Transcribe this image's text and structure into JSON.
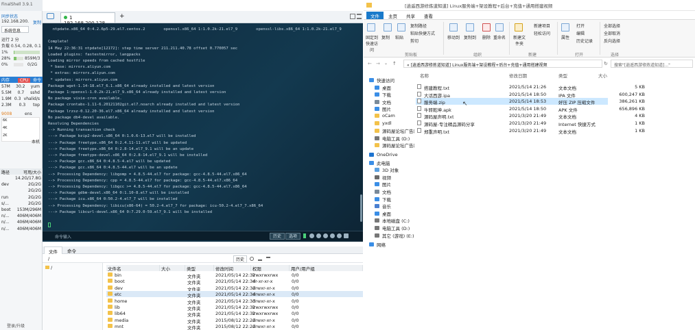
{
  "finalshell": {
    "title": "FinalShell 3.9.1",
    "sync_label": "同步状态",
    "host": "192.168.200.1...",
    "copy_label": "复制",
    "sysinfo_button": "系统信息",
    "uptime": "运行 2 分",
    "load": "负载 0.54, 0.28, 0.11",
    "cpu_pct": "1%",
    "cpu_fill": 0.01,
    "mem_pct": "28%",
    "mem_value": "859M/3",
    "mem_fill": 0.28,
    "swap_pct": "0%",
    "swap_value": "0/2G",
    "swap_fill": 0.0,
    "proc_header": {
      "mem": "内存",
      "cpu": "CPU",
      "cmd": "命令"
    },
    "processes": [
      {
        "mem": "57M",
        "cpu": "30.2",
        "cmd": "yum"
      },
      {
        "mem": "5.5M",
        "cpu": "0.7",
        "cmd": "sshd"
      },
      {
        "mem": "1.9M",
        "cpu": "0.3",
        "cmd": "vhalid/s"
      },
      {
        "mem": "2.3M",
        "cpu": "0.3",
        "cmd": "top"
      }
    ],
    "net_up": "9008",
    "net_label": "ens",
    "net_axis": [
      "6K",
      "4K",
      "2K"
    ],
    "net_host_label": "本机",
    "disk_header": {
      "path": "路径",
      "free": "可用/大小"
    },
    "disks": [
      {
        "path": "",
        "free": "14.2G/17.8G"
      },
      {
        "path": "dev",
        "free": "2G/2G"
      },
      {
        "path": "",
        "free": "2G/2G"
      },
      {
        "path": "run",
        "free": "2G/2G"
      },
      {
        "path": "s/...",
        "free": "2G/2G"
      },
      {
        "path": "boot",
        "free": "153M/296M"
      },
      {
        "path": "n/...",
        "free": "406M/406M"
      },
      {
        "path": "n/...",
        "free": "406M/406M"
      },
      {
        "path": "n/...",
        "free": "406M/406M"
      }
    ],
    "login_link": "登录/升级",
    "tab_label": "1 192.168.200.128",
    "add_tab": "+",
    "terminal_lines": [
      "  ntpdate.x86_64 0:4.2.6p5-29.el7.centos.2        openssl.x86_64 1:1.0.2k-21.el7_9        openssl-libs.x86_64 1:1.0.2k-21.el7_9",
      "",
      "Complete!",
      "14 May 22:36:31 ntpdate[12172]: step time server 211.211.40.78 offset 0.770057 sec",
      "Loaded plugins: fastestmirror, langpacks",
      "Loading mirror speeds from cached hostfile",
      " * base: mirrors.aliyun.com",
      " * extras: mirrors.aliyun.com",
      " * updates: mirrors.aliyun.com",
      "Package wget-1.14-18.el7_6.1.x86_64 already installed and latest version",
      "Package 1:openssl-1.0.2k-21.el7_9.x86_64 already installed and latest version",
      "No package vixie-cron available.",
      "Package crontabs-1.11-6.20121102git.el7.noarch already installed and latest version",
      "Package lrzsz-0.12.20-36.el7.x86_64 already installed and latest version",
      "No package db4-devel available.",
      "Resolving Dependencies",
      "--> Running transaction check",
      "---> Package bzip2-devel.x86_64 0:1.0.6-13.el7 will be installed",
      "---> Package freetype.x86_64 0:2.4.11-11.el7 will be updated",
      "---> Package freetype.x86_64 0:2.8-14.el7_9.1 will be an update",
      "---> Package freetype-devel.x86_64 0:2.8-14.el7_9.1 will be installed",
      "---> Package gcc.x86_64 0:4.8.5-4.el7 will be updated",
      "---> Package gcc.x86_64 0:4.8.5-44.el7 will be an update",
      "--> Processing Dependency: libgomp = 4.8.5-44.el7 for package: gcc-4.8.5-44.el7.x86_64",
      "--> Processing Dependency: cpp = 4.8.5-44.el7 for package: gcc-4.8.5-44.el7.x86_64",
      "--> Processing Dependency: libgcc >= 4.8.5-44.el7 for package: gcc-4.8.5-44.el7.x86_64",
      "---> Package gdbm-devel.x86_64 0:1.10-8.el7 will be installed",
      "---> Package icu.x86_64 0:50.2-4.el7_7 will be installed",
      "--> Processing Dependency: libicu(x86-64) = 50.2-4.el7_7 for package: icu-50.2-4.el7_7.x86_64",
      "---> Package libcurl-devel.x86_64 0:7.29.0-59.el7_9.1 will be installed"
    ],
    "command_input_label": "命令输入",
    "history_button": "历史",
    "options_button": "选项",
    "file_tabs": [
      "文件",
      "命令"
    ],
    "file_path": "/",
    "file_history": "历史",
    "file_columns": [
      "文件名",
      "大小",
      "类型",
      "修改时间",
      "权限",
      "用户/用户组"
    ],
    "files": [
      {
        "name": "bin",
        "size": "",
        "type": "文件夹",
        "mtime": "2021/05/14 22:32",
        "perm": "lrwxrwxrwx",
        "owner": "0/0"
      },
      {
        "name": "boot",
        "size": "",
        "type": "文件夹",
        "mtime": "2021/05/14 22:34",
        "perm": "dr-xr-xr-x",
        "owner": "0/0"
      },
      {
        "name": "dev",
        "size": "",
        "type": "文件夹",
        "mtime": "2021/05/14 22:32",
        "perm": "drwxr-xr-x",
        "owner": "0/0"
      },
      {
        "name": "etc",
        "size": "",
        "type": "文件夹",
        "mtime": "2021/05/14 22:34",
        "perm": "drwxr-xr-x",
        "owner": "0/0"
      },
      {
        "name": "home",
        "size": "",
        "type": "文件夹",
        "mtime": "2021/05/14 22:33",
        "perm": "drwxr-xr-x",
        "owner": "0/0"
      },
      {
        "name": "lib",
        "size": "",
        "type": "文件夹",
        "mtime": "2021/05/14 22:32",
        "perm": "lrwxrwxrwx",
        "owner": "0/0"
      },
      {
        "name": "lib64",
        "size": "",
        "type": "文件夹",
        "mtime": "2021/05/14 22:32",
        "perm": "lrwxrwxrwx",
        "owner": "0/0"
      },
      {
        "name": "media",
        "size": "",
        "type": "文件夹",
        "mtime": "2015/08/12 22:22",
        "perm": "drwxr-xr-x",
        "owner": "0/0"
      },
      {
        "name": "mnt",
        "size": "",
        "type": "文件夹",
        "mtime": "2015/08/12 22:22",
        "perm": "drwxr-xr-x",
        "owner": "0/0"
      }
    ]
  },
  "explorer": {
    "title": "[逍遥西游修炼道知道] Linux服务端+架设教程+后台+充值+通用搭建视频",
    "ribbon_tabs": [
      "文件",
      "主页",
      "共享",
      "查看"
    ],
    "ribbon_buttons": {
      "pin": "固定到快速访问",
      "copy": "复制",
      "paste": "粘贴",
      "copy_path": "复制路径",
      "paste_shortcut": "粘贴快捷方式",
      "cut": "剪切",
      "move_to": "移动到",
      "copy_to": "复制到",
      "delete": "删除",
      "rename": "重命名",
      "new_folder": "新建文件夹",
      "new_item": "新建项目",
      "easy_access": "轻松访问",
      "properties": "属性",
      "open": "打开",
      "edit": "编辑",
      "history": "历史记录",
      "select_all": "全部选择",
      "select_none": "全部取消",
      "invert": "反向选择"
    },
    "ribbon_groups": [
      "剪贴板",
      "组织",
      "新建",
      "打开",
      "选择"
    ],
    "address": "« [逍遥西游修炼道知道] Linux服务端+架设教程+后台+充值+通用搭建视频",
    "search_placeholder": "搜索\"[逍遥西游修炼道知道]...\"",
    "nav_items": [
      "快速访问",
      "桌面",
      "下载",
      "文档",
      "图片",
      "oCam",
      "yxdl",
      "源码屋论坛广告教程",
      "电脑工具 (D:)",
      "源码屋论坛广告教程",
      "OneDrive",
      "此电脑",
      "3D 对象",
      "视频",
      "图片",
      "文档",
      "下载",
      "音乐",
      "桌面",
      "本地磁盘 (C:)",
      "电脑工具 (D:)",
      "其它 (游戏) (E:)",
      "网络"
    ],
    "columns": [
      "名称",
      "修改日期",
      "类型",
      "大小"
    ],
    "files": [
      {
        "name": "搭建教程.txt",
        "date": "2021/5/14 21:26",
        "type": "文本文档",
        "size": "5 KB"
      },
      {
        "name": "大话西游.ipa",
        "date": "2021/5/14 18:50",
        "type": "IPA 文件",
        "size": "600,247 KB"
      },
      {
        "name": "服务端.zip",
        "date": "2021/5/14 18:53",
        "type": "好压 ZIP 压缩文件",
        "size": "386,261 KB"
      },
      {
        "name": "牛转乾坤.apk",
        "date": "2021/5/14 18:50",
        "type": "APK 文件",
        "size": "656,896 KB"
      },
      {
        "name": "源码屋声明.txt",
        "date": "2021/3/20 21:49",
        "type": "文本文档",
        "size": "4 KB"
      },
      {
        "name": "源码屋-专注精品源码分享",
        "date": "2021/3/20 21:49",
        "type": "Internet 快捷方式",
        "size": "1 KB"
      },
      {
        "name": "郑重声明.txt",
        "date": "2021/3/20 21:49",
        "type": "文本文档",
        "size": "1 KB"
      }
    ]
  }
}
